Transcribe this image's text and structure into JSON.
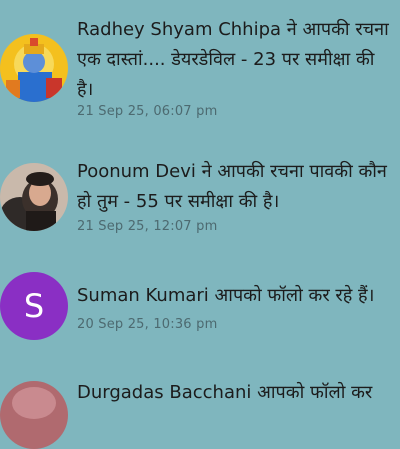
{
  "notifications": [
    {
      "avatar": "krishna-avatar",
      "name": "Radhey Shyam Chhipa",
      "text": "ने आपकी रचना एक दास्तां.... डेयरडेविल - 23 पर समीक्षा की है।",
      "time": "21 Sep 25, 06:07 pm"
    },
    {
      "avatar": "doll-avatar",
      "name": "Poonum Devi",
      "text": "ने आपकी रचना पावकी कौन हो तुम - 55 पर समीक्षा की है।",
      "time": "21 Sep 25, 12:07 pm"
    },
    {
      "avatar": "letter-avatar",
      "avatar_letter": "S",
      "avatar_color": "#8a2fc4",
      "name": "Suman Kumari",
      "text": "आपको फॉलो कर रहे हैं।",
      "time": "20 Sep 25, 10:36 pm"
    },
    {
      "avatar": "photo-avatar",
      "name": "Durgadas Bacchani",
      "text": "आपको फॉलो कर"
    }
  ]
}
